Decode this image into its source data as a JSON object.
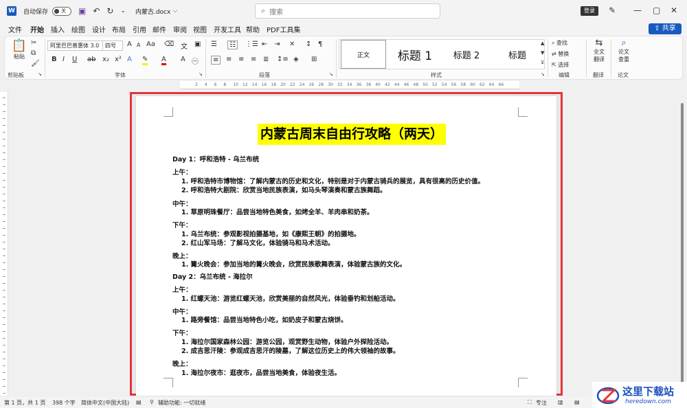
{
  "titlebar": {
    "app_logo": "W",
    "autosave_label": "自动保存",
    "autosave_state": "关",
    "doc_name": "内蒙古.docx",
    "doc_chevron": "⌵",
    "search_placeholder": "搜索",
    "login": "登录"
  },
  "menu": {
    "tabs": [
      "文件",
      "开始",
      "插入",
      "绘图",
      "设计",
      "布局",
      "引用",
      "邮件",
      "审阅",
      "视图",
      "开发工具",
      "帮助",
      "PDF工具集"
    ],
    "share": "共享"
  },
  "ribbon": {
    "clipboard": {
      "paste": "粘贴",
      "label": "剪贴板"
    },
    "font": {
      "name": "阿里巴巴普惠体 3.0",
      "size": "四号",
      "grow": "A",
      "shrink": "A",
      "case": "Aa",
      "label": "字体"
    },
    "paragraph": {
      "label": "段落"
    },
    "styles": {
      "items": [
        "正文",
        "标题 1",
        "标题 2",
        "标题"
      ],
      "label": "样式"
    },
    "editing": {
      "find": "查找",
      "replace": "替换",
      "select": "选择",
      "label": "编辑"
    },
    "translate": {
      "button_line1": "全文",
      "button_line2": "翻译",
      "label": "翻译"
    },
    "paper": {
      "button_line1": "论文",
      "button_line2": "查重",
      "label": "论文"
    }
  },
  "ruler": {
    "marks": [
      "2",
      "4",
      "6",
      "8",
      "10",
      "12",
      "14",
      "16",
      "18",
      "20",
      "22",
      "24",
      "26",
      "28",
      "30",
      "32",
      "34",
      "36",
      "38",
      "40",
      "42",
      "44",
      "46",
      "48",
      "50",
      "52",
      "54",
      "56",
      "58",
      "60",
      "62",
      "64",
      "66"
    ]
  },
  "document": {
    "title": "内蒙古周末自由行攻略（两天）",
    "lines": [
      "Day 1：呼和浩特 - 乌兰布统",
      "上午：",
      "1.  呼和浩特市博物馆：了解内蒙古的历史和文化，特别是对于内蒙古骑兵的展览，具有很高的历史价值。",
      "2.  呼和浩特大剧院：欣赏当地民族表演，如马头琴演奏和蒙古族舞蹈。",
      "中午：",
      "1.  草原明珠餐厅：品尝当地特色美食，如烤全羊、羊肉串和奶茶。",
      "下午：",
      "1.  乌兰布统：参观影视拍摄基地，如《康熙王朝》的拍摄地。",
      "2.  红山军马场：了解马文化，体验骑马和马术活动。",
      "晚上：",
      "1.  篝火晚会：参加当地的篝火晚会，欣赏民族歌舞表演，体验蒙古族的文化。",
      "Day 2：乌兰布统 - 海拉尔",
      "上午：",
      "1.  红螺天池：游览红螺天池，欣赏美丽的自然风光，体验垂钓和划船活动。",
      "中午：",
      "1.  路旁餐馆：品尝当地特色小吃，如奶皮子和蒙古烧饼。",
      "下午：",
      "1.  海拉尔国家森林公园：游览公园，观赏野生动物，体验户外探险活动。",
      "2.  成吉思汗陵：参观成吉思汗的陵墓，了解这位历史上的伟大领袖的故事。",
      "晚上：",
      "1.  海拉尔夜市：逛夜市，品尝当地美食，体验夜生活。"
    ]
  },
  "status": {
    "page": "第 1 页，共 1 页",
    "words": "398 个字",
    "language": "简体中文(中国大陆)",
    "accessibility": "辅助功能: 一切就绪",
    "focus": "专注"
  },
  "watermark": {
    "cn": "这里下载站",
    "en": "heredown.com"
  },
  "colors": {
    "accent": "#185abd",
    "highlight": "#ffff00",
    "frame": "#e3333b"
  }
}
